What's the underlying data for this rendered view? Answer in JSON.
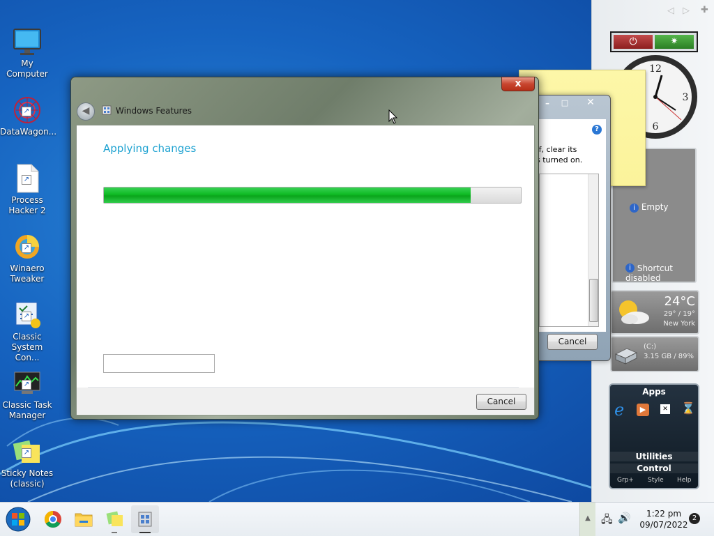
{
  "desktop_icons": [
    {
      "label": "My Computer"
    },
    {
      "label": "DataWagon..."
    },
    {
      "label": "Process\nHacker 2"
    },
    {
      "label": "Winaero\nTweaker"
    },
    {
      "label": "Classic\nSystem Con..."
    },
    {
      "label": "Classic Task\nManager"
    },
    {
      "label": "Sticky Notes\n(classic)"
    }
  ],
  "dialog": {
    "title": "Windows Features",
    "heading": "Applying changes",
    "progress": 0.88,
    "cancel_label": "Cancel",
    "close_glyph": "x"
  },
  "bg_dialog": {
    "text_line1": "ff, clear its",
    "text_line2": "s turned on.",
    "cancel_label": "Cancel",
    "help_glyph": "?"
  },
  "gadgets": {
    "slideshow": {
      "empty": "Empty",
      "shortcut": "Shortcut disabled"
    },
    "weather": {
      "temp": "24°C",
      "range": "29° / 19°",
      "city": "New York"
    },
    "drive": {
      "name": "(C:)",
      "info": "3.15 GB / 89%"
    },
    "apps": {
      "title": "Apps",
      "utilities": "Utilities",
      "control": "Control",
      "footer": [
        "Grp+",
        "Style",
        "Help"
      ]
    }
  },
  "taskbar": {
    "time": "1:22 pm",
    "date": "09/07/2022",
    "notification_count": "2"
  },
  "colors": {
    "heading": "#1ea2d1",
    "progress_fill": "#0fbb24",
    "desktop": "#1663c0"
  }
}
